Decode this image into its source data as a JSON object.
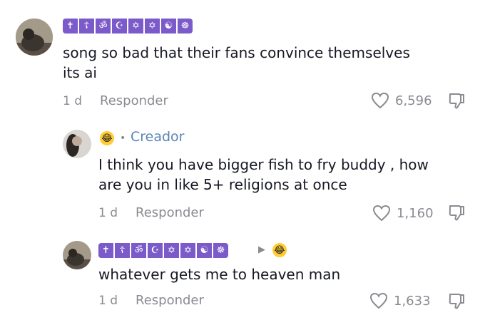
{
  "comments": [
    {
      "badges": [
        "✝",
        "☦",
        "ॐ",
        "☪",
        "✡",
        "✡",
        "☯",
        "☸"
      ],
      "text_line1": "song so bad that their fans convince themselves",
      "text_line2": "its ai",
      "time": "1 d",
      "reply_label": "Responder",
      "likes": "6,596"
    },
    {
      "creator_label": "Creador",
      "text_line1": "I think you have bigger fish to fry buddy , how",
      "text_line2": "are you in like 5+ religions at once",
      "time": "1 d",
      "reply_label": "Responder",
      "likes": "1,160"
    },
    {
      "badges": [
        "✝",
        "☦",
        "ॐ",
        "☪",
        "✡",
        "✡",
        "☯",
        "☸"
      ],
      "text_line1": "whatever gets me to heaven man",
      "time": "1 d",
      "reply_label": "Responder",
      "likes": "1,633"
    }
  ],
  "icons": {
    "heart": "heart-outline-icon",
    "dislike": "thumbs-down-icon",
    "laugh_emoji": "laughing-emoji-icon",
    "reply_arrow": "reply-arrow-icon"
  },
  "colors": {
    "badge_bg": "#7b5ac9",
    "creator_label": "#5b85b5",
    "meta_gray": "#8a8b91"
  }
}
